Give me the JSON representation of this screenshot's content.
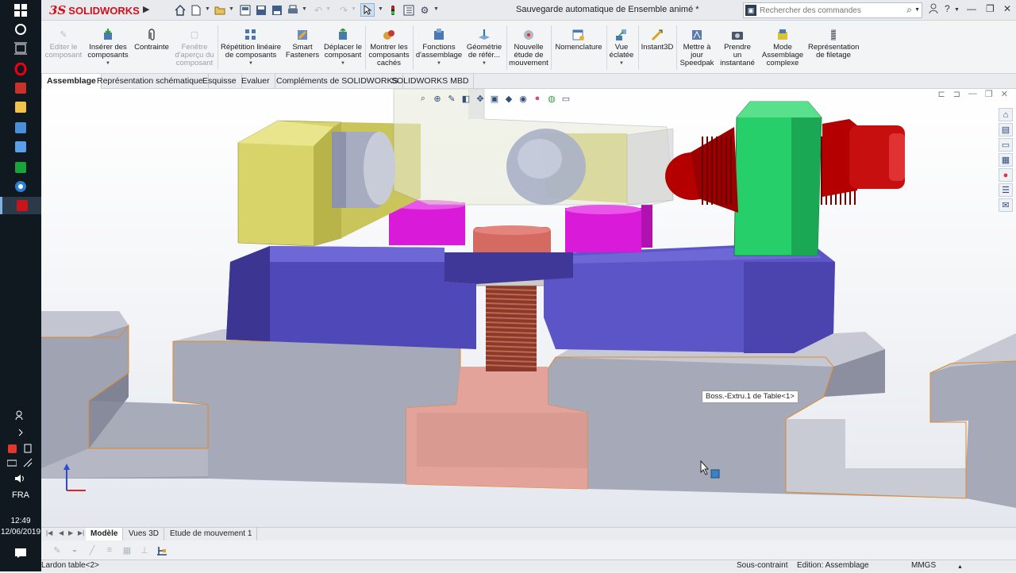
{
  "taskbar": {
    "language": "FRA",
    "time": "12:49",
    "date": "12/06/2019"
  },
  "app": {
    "logo_ds": "3S",
    "logo_text": "SOLIDWORKS",
    "document_title": "Sauvegarde automatique de Ensemble animé *",
    "search_placeholder": "Rechercher des commandes"
  },
  "ribbon": [
    {
      "label": "Editer le\ncomposant",
      "enabled": false
    },
    {
      "label": "Insérer des\ncomposants",
      "enabled": true
    },
    {
      "label": "Contrainte",
      "enabled": true
    },
    {
      "label": "Fenêtre\nd'aperçu du\ncomposant",
      "enabled": false
    },
    {
      "label": "Répétition linéaire\nde composants",
      "enabled": true
    },
    {
      "label": "Smart\nFasteners",
      "enabled": true
    },
    {
      "label": "Déplacer le\ncomposant",
      "enabled": true
    },
    {
      "label": "Montrer les\ncomposants\ncachés",
      "enabled": true
    },
    {
      "label": "Fonctions\nd'assemblage",
      "enabled": true
    },
    {
      "label": "Géométrie\nde référ...",
      "enabled": true
    },
    {
      "label": "Nouvelle\nétude de\nmouvement",
      "enabled": true
    },
    {
      "label": "Nomenclature",
      "enabled": true
    },
    {
      "label": "Vue\néclatée",
      "enabled": true
    },
    {
      "label": "Instant3D",
      "enabled": true
    },
    {
      "label": "Mettre à\njour\nSpeedpak",
      "enabled": true
    },
    {
      "label": "Prendre\nun\ninstantané",
      "enabled": true
    },
    {
      "label": "Mode\nAssemblage\ncomplexe",
      "enabled": true
    },
    {
      "label": "Représentation\nde filetage",
      "enabled": true
    }
  ],
  "command_tabs": [
    "Assemblage",
    "Représentation schématique",
    "Esquisse",
    "Evaluer",
    "Compléments de SOLIDWORKS",
    "SOLIDWORKS MBD"
  ],
  "active_command_tab": "Assemblage",
  "tooltip": "Boss.-Extru.1 de Table<1>",
  "bottom_tabs": [
    "Modèle",
    "Vues 3D",
    "Etude de mouvement 1"
  ],
  "active_bottom_tab": "Modèle",
  "status": {
    "left": "Lardon table<2>",
    "constraint": "Sous-contraint",
    "edit": "Edition: Assemblage",
    "units": "MMGS"
  },
  "colors": {
    "accent": "#d0111b",
    "yellow_part": "#d8d46a",
    "magenta_part": "#d91ad9",
    "blue_part": "#5a54c0",
    "green_part": "#26cf6a",
    "red_part": "#b50000",
    "grey_table": "#9fa3b2"
  }
}
